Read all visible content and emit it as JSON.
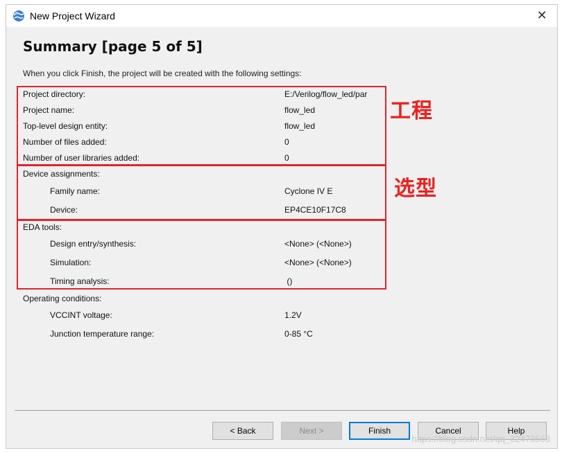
{
  "window": {
    "title": "New Project Wizard",
    "close_glyph": "✕"
  },
  "page": {
    "heading": "Summary [page 5 of 5]",
    "intro": "When you click Finish, the project will be created with the following settings:"
  },
  "summary": {
    "project_directory": {
      "label": "Project directory:",
      "value": "E:/Verilog/flow_led/par"
    },
    "project_name": {
      "label": "Project name:",
      "value": "flow_led"
    },
    "top_level_entity": {
      "label": "Top-level design entity:",
      "value": "flow_led"
    },
    "files_added": {
      "label": "Number of files added:",
      "value": "0"
    },
    "user_libraries": {
      "label": "Number of user libraries added:",
      "value": "0"
    },
    "device_assignments": {
      "label": "Device assignments:"
    },
    "family_name": {
      "label": "Family name:",
      "value": "Cyclone IV E"
    },
    "device": {
      "label": "Device:",
      "value": "EP4CE10F17C8"
    },
    "eda_tools": {
      "label": "EDA tools:"
    },
    "design_entry": {
      "label": "Design entry/synthesis:",
      "value": "<None> (<None>)"
    },
    "simulation": {
      "label": "Simulation:",
      "value": "<None> (<None>)"
    },
    "timing_analysis": {
      "label": "Timing analysis:",
      "value": " ()"
    },
    "operating_conditions": {
      "label": "Operating conditions:"
    },
    "vccint": {
      "label": "VCCINT voltage:",
      "value": "1.2V"
    },
    "junction_temp": {
      "label": "Junction temperature range:",
      "value": "0-85 °C"
    }
  },
  "annotations": {
    "project_group": "工程",
    "device_group": "选型"
  },
  "buttons": {
    "back": "< Back",
    "next": "Next >",
    "finish": "Finish",
    "cancel": "Cancel",
    "help": "Help"
  },
  "watermark": "https://blog.csdn.net/qq_32473563",
  "colors": {
    "annotation_red": "#e0242c",
    "default_button_border": "#0078d7",
    "dialog_background": "#f0f0f0"
  },
  "icons": {
    "app": "quartus-globe-icon",
    "close": "close-icon"
  }
}
